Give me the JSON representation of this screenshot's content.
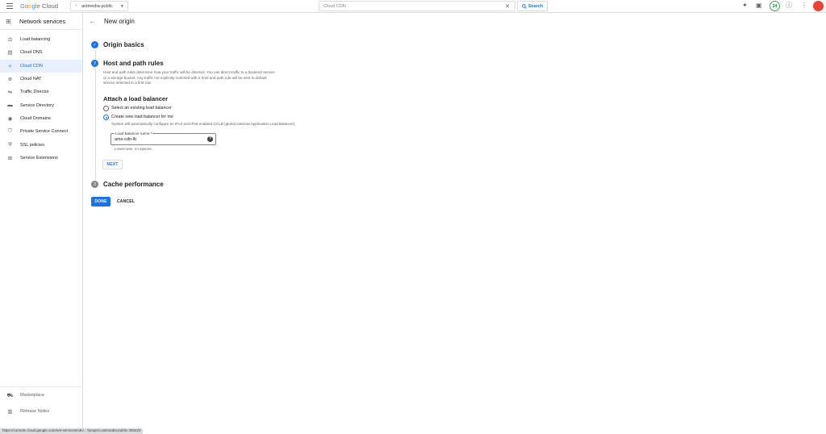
{
  "header": {
    "logo": {
      "google": "Google",
      "cloud": "Cloud"
    },
    "project": "antmedia-public",
    "search": {
      "value": "Cloud CDN",
      "button": "Search"
    },
    "notifications_count": "24",
    "icons": [
      "gemini-spark-icon",
      "cloud-shell-icon",
      "help-icon",
      "more-vert-icon",
      "avatar"
    ]
  },
  "sidebar": {
    "title": "Network services",
    "items": [
      {
        "label": "Load balancing",
        "icon": "load-balancing-icon"
      },
      {
        "label": "Cloud DNS",
        "icon": "dns-icon"
      },
      {
        "label": "Cloud CDN",
        "icon": "cdn-icon",
        "active": true
      },
      {
        "label": "Cloud NAT",
        "icon": "nat-icon"
      },
      {
        "label": "Traffic Director",
        "icon": "traffic-director-icon"
      },
      {
        "label": "Service Directory",
        "icon": "service-directory-icon"
      },
      {
        "label": "Cloud Domains",
        "icon": "domains-icon"
      },
      {
        "label": "Private Service Connect",
        "icon": "private-service-connect-icon"
      },
      {
        "label": "SSL policies",
        "icon": "ssl-icon"
      },
      {
        "label": "Service Extensions",
        "icon": "service-extensions-icon"
      }
    ],
    "bottom": [
      {
        "label": "Marketplace",
        "icon": "marketplace-icon"
      },
      {
        "label": "Release Notes",
        "icon": "release-notes-icon"
      }
    ]
  },
  "status_url": "https://console.cloud.google.com/net-services/cdn/...?project=antmedia-public-393420",
  "main": {
    "title": "New origin",
    "steps": [
      {
        "number": "1",
        "label": "Origin basics",
        "state": "complete"
      },
      {
        "number": "2",
        "label": "Host and path rules",
        "state": "active"
      },
      {
        "number": "3",
        "label": "Cache performance",
        "state": "pending"
      }
    ],
    "description": "Host and path rules determine how your traffic will be directed. You can direct traffic to a backend service or a storage bucket. Any traffic not explicitly matched with a host and path rule will be sent to default service selected in a first row.",
    "attach": {
      "title": "Attach a load balancer",
      "option_existing": "Select an existing load balancer",
      "option_new": "Create new load balancer for me",
      "option_new_help": "System will automatically configure an IPv4 and IPv6 enabled GCLB (global external Application Load Balancer).",
      "field_label": "Load Balancer name *",
      "field_value": "ams-cdn-lb",
      "field_hint": "Lowercase, no spaces.",
      "next_label": "NEXT"
    },
    "done_label": "DONE",
    "cancel_label": "CANCEL"
  },
  "colors": {
    "accent": "#1a73e8",
    "active_bg": "#e8f0fe",
    "badge_green": "#34a853",
    "avatar_red": "#ea4335"
  }
}
